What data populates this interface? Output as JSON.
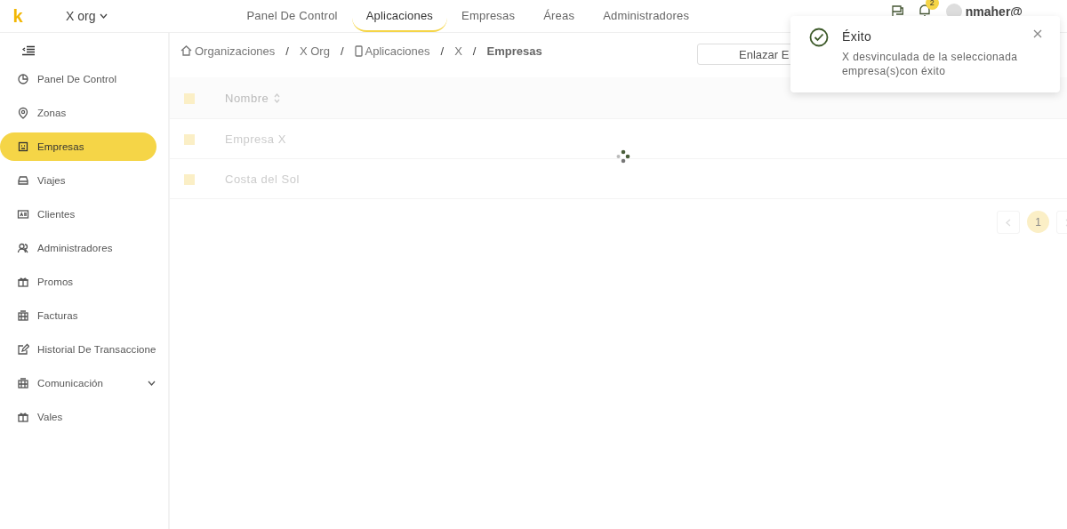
{
  "header": {
    "logo": "k",
    "org": "X org",
    "tabs": [
      {
        "label": "Panel De Control",
        "selected": false
      },
      {
        "label": "Aplicaciones",
        "selected": true
      },
      {
        "label": "Empresas",
        "selected": false
      },
      {
        "label": "Áreas",
        "selected": false
      },
      {
        "label": "Administradores",
        "selected": false
      }
    ],
    "notifications_badge": "2",
    "user": "nmaher@"
  },
  "sidebar": {
    "items": [
      {
        "label": "Panel De Control",
        "kind": "link",
        "selected": false
      },
      {
        "label": "Zonas",
        "kind": "link",
        "selected": false
      },
      {
        "label": "Empresas",
        "kind": "link",
        "selected": true
      },
      {
        "label": "Viajes",
        "kind": "link",
        "selected": false
      },
      {
        "label": "Clientes",
        "kind": "link",
        "selected": false
      },
      {
        "label": "Administradores",
        "kind": "link",
        "selected": false
      },
      {
        "label": "Promos",
        "kind": "link",
        "selected": false
      },
      {
        "label": "Facturas",
        "kind": "link",
        "selected": false
      },
      {
        "label": "Historial De Transaccione",
        "kind": "link",
        "selected": false
      },
      {
        "label": "Comunicación",
        "kind": "submenu",
        "selected": false
      },
      {
        "label": "Vales",
        "kind": "link",
        "selected": false
      }
    ]
  },
  "breadcrumb": [
    {
      "label": "Organizaciones",
      "kind": "home",
      "separator": "/"
    },
    {
      "label": "X Org",
      "kind": "plain",
      "separator": "/"
    },
    {
      "label": "Aplicaciones",
      "kind": "app",
      "separator": "/"
    },
    {
      "label": "X",
      "kind": "plain",
      "separator": "/"
    },
    {
      "label": "Empresas",
      "kind": "current"
    }
  ],
  "toolbar": {
    "button": "Enlazar E"
  },
  "table": {
    "loading": true,
    "select_all_checked": false,
    "columns": [
      "Nombre"
    ],
    "rows": [
      {
        "cells": [
          "Empresa X"
        ],
        "checked": false
      },
      {
        "cells": [
          "Costa del Sol"
        ],
        "checked": false
      }
    ]
  },
  "pagination": {
    "pages": [
      {
        "label": "1",
        "selected": true
      }
    ]
  },
  "toast": {
    "kind": "success",
    "title": "Éxito",
    "message": "X desvinculada de la seleccionada empresa(s)con éxito"
  }
}
